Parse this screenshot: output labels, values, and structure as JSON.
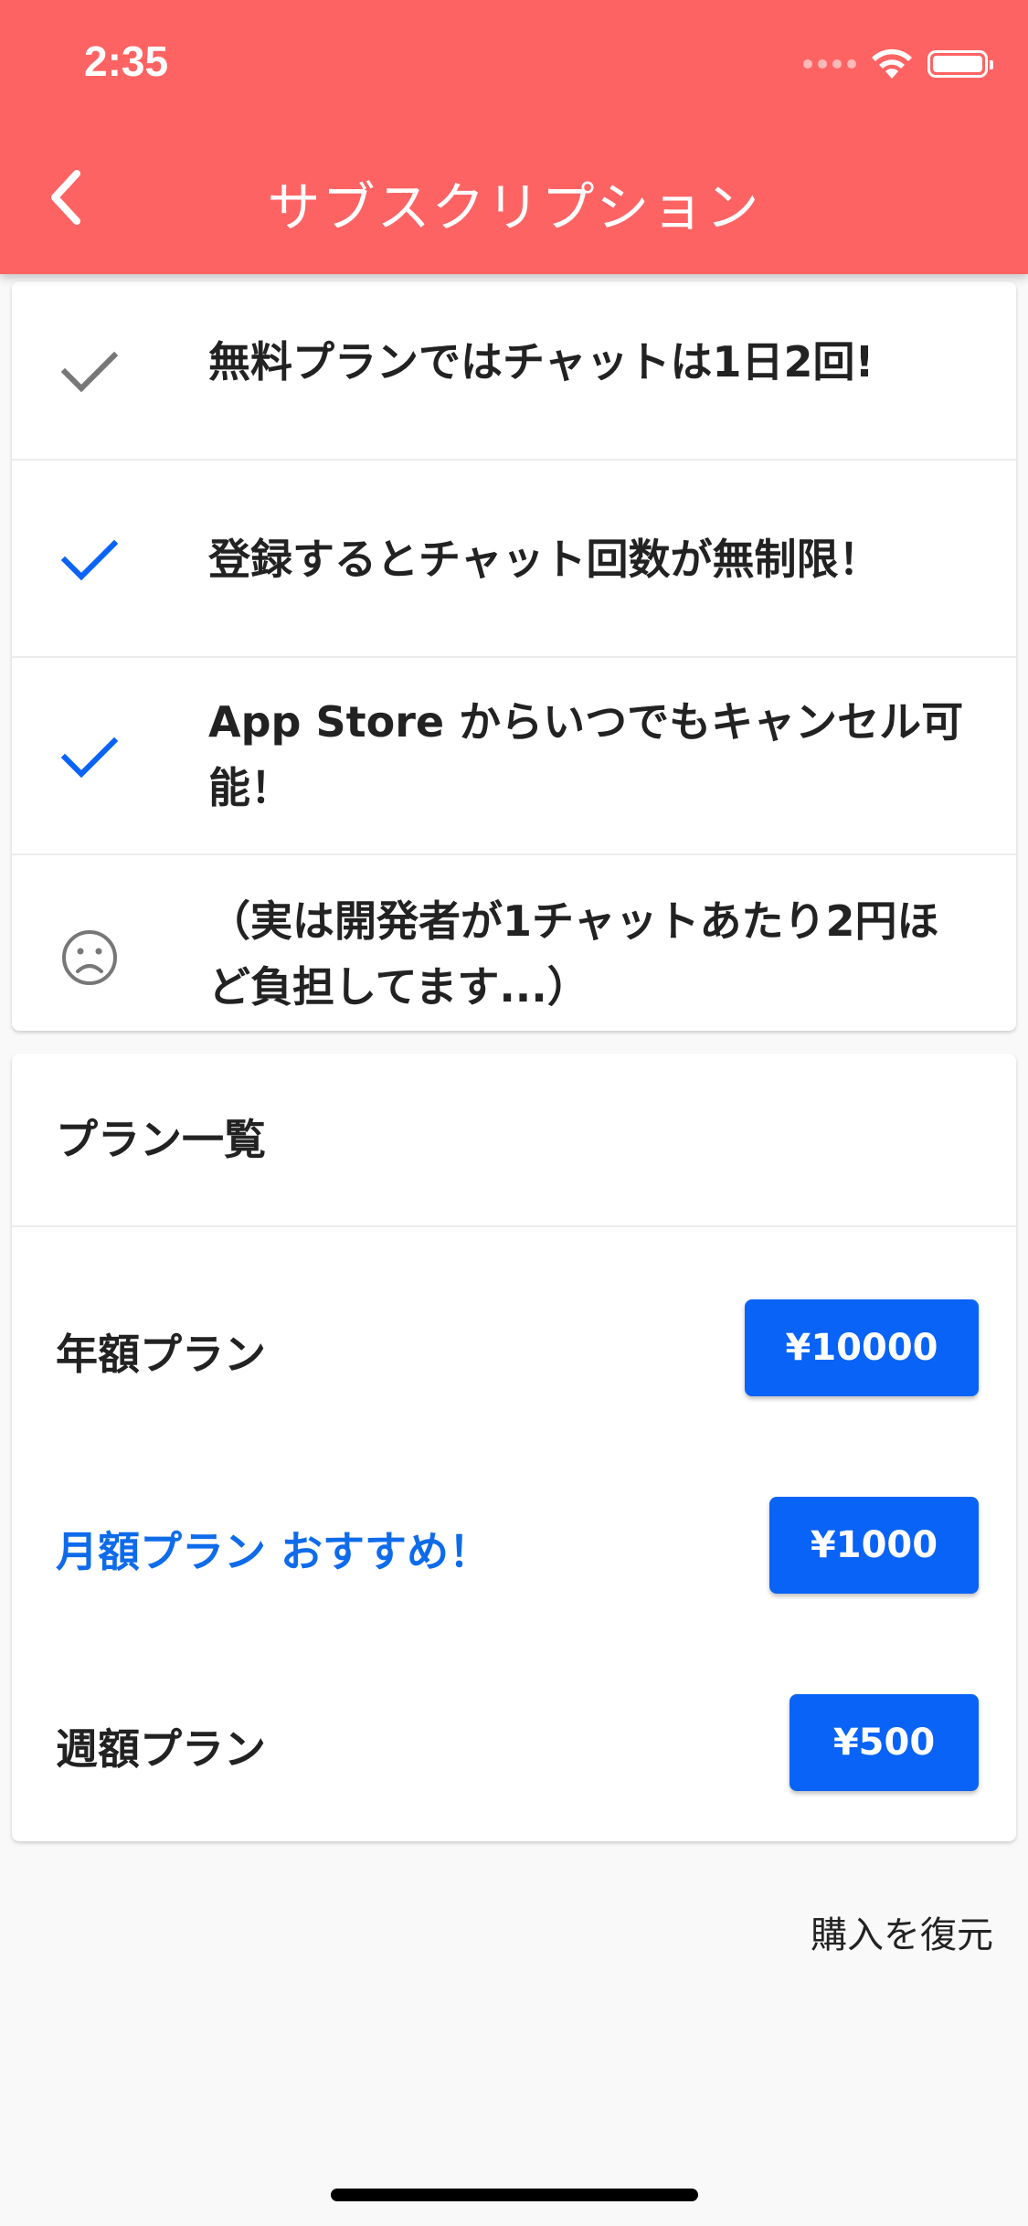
{
  "status_bar": {
    "time": "2:35"
  },
  "app_bar": {
    "title": "サブスクリプション",
    "back_icon": "chevron-left-icon"
  },
  "features": [
    {
      "icon": "check-icon",
      "icon_color": "#777777",
      "text": "無料プランではチャットは1日2回!"
    },
    {
      "icon": "check-icon",
      "icon_color": "#0863f6",
      "text": "登録するとチャット回数が無制限！"
    },
    {
      "icon": "check-icon",
      "icon_color": "#0863f6",
      "text": "App Store からいつでもキャンセル可能！"
    },
    {
      "icon": "sad-face-icon",
      "icon_color": "#777777",
      "text": "（実は開発者が1チャットあたり2円ほど負担してます...）"
    }
  ],
  "plans": {
    "title": "プラン一覧",
    "items": [
      {
        "label": "年額プラン",
        "price": "¥10000",
        "recommended": false
      },
      {
        "label": "月額プラン おすすめ！",
        "price": "¥1000",
        "recommended": true
      },
      {
        "label": "週額プラン",
        "price": "¥500",
        "recommended": false
      }
    ]
  },
  "restore": {
    "label": "購入を復元"
  },
  "colors": {
    "app_bar": "#fe6363",
    "accent": "#0863f6",
    "recommended_text": "#0e6bea"
  }
}
